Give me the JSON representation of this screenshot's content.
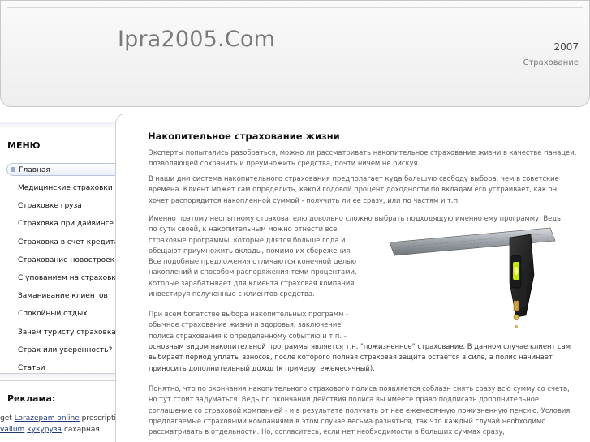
{
  "header": {
    "site_title": "Ipra2005.Com",
    "year": "2007",
    "tagline": "Страхование"
  },
  "sidebar": {
    "menu_heading": "МЕНЮ",
    "items": [
      {
        "label": "Главная",
        "active": true
      },
      {
        "label": "Медицинские страховки"
      },
      {
        "label": "Страховке груза"
      },
      {
        "label": "Страховка при дайвинге"
      },
      {
        "label": "Страховка в счет кредита"
      },
      {
        "label": "Страхование новостроек"
      },
      {
        "label": "С упованием на страховку"
      },
      {
        "label": "Заманивание клиентов"
      },
      {
        "label": "Спокойный отдых"
      },
      {
        "label": "Зачем туристу страховка?"
      },
      {
        "label": "Страх или уверенность?"
      },
      {
        "label": "Статьи"
      }
    ],
    "ads_heading": "Реклама:",
    "ads": {
      "pre1": "get ",
      "link1": "Lorazepam online",
      "mid1": " prescription",
      "link2": "valium",
      "space": " ",
      "link3": "кукуруза",
      "post": " сахарная"
    }
  },
  "main": {
    "title": "Накопительное страхование жизни",
    "p1": "Эксперты попытались разобраться, можно ли рассматривать накопительное страхование жизни в качестве панацеи, позволяющей сохранить и преумножить средства, почти ничем не рискуя.",
    "p2": "В наши дни система накопительного страхования предполагает куда большую свободу выбора, чем в советские времена. Клиент может сам определить, какой годовой процент доходности по вкладам его устраивает, как он хочет распорядится накопленной суммой - получить ли ее сразу, или по частям и т.п.",
    "p3_line1": "Именно поэтому неопытному страхователю довольно сложно выбрать подходящую именно ему программу. Ведь,",
    "p3_rest": "по сути своей, к накопительным можно отнести все страховые программы, которые длятся больше года и обещают приумножить вклады, помимо их сбережения. Все подобные предложения отличаются конечной целью накоплений и способом распоряжения теми процентами, которые зарабатывает для клиента страховая компания, инвестируя полученные с клиентов средства.",
    "p4_rest": "При всем богатстве выбора накопительных программ - обычное страхование жизни и здоровья, заключение полиса страхования к определенному событию и т.п. -",
    "p4_full": "основным видом накопительной программы является т.н. \"пожизненное\" страхование. В данном случае клиент сам выбирает период уплаты взносов, после которого полная страховая защита остается в силе, а полис начинает приносить дополнительный доход (к примеру, ежемесячный).",
    "p5": "Понятно, что по окончания накопительного страхового полиса появляется соблазн снять сразу всю сумму со счета, но тут стоит задуматься. Ведь по окончании действия полиса вы имеете право подписать дополнительное соглашение со страховой компанией - и в результате получать от нее ежемесячную пожизненную пенсию. Условия, предлагаемые страховыми компаниями в этом случае весьма разняться, так что каждый случай необходимо рассматривать в отдельности. Но, согласитесь, если нет необходимости в больших суммах сразу,"
  }
}
